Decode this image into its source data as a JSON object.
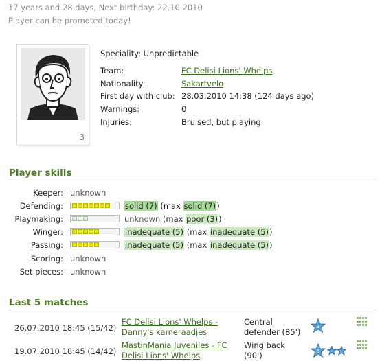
{
  "header": {
    "age_line": "17 years and 28 days, Next birthday: 22.10.2010",
    "promotion_line": "Player can be promoted today!"
  },
  "avatar": {
    "badge": "3"
  },
  "info": {
    "speciality_label": "Speciality:",
    "speciality_value": "Unpredictable",
    "team_label": "Team:",
    "team_value": "FC Delisi Lions' Whelps",
    "nationality_label": "Nationality:",
    "nationality_value": "Sakartvelo",
    "first_day_label": "First day with club:",
    "first_day_value": "28.03.2010 14:38 (124 days ago)",
    "warnings_label": "Warnings:",
    "warnings_value": "0",
    "injuries_label": "Injuries:",
    "injuries_value": "Bruised, but playing"
  },
  "skills": {
    "title": "Player skills",
    "rows": [
      {
        "label": "Keeper:",
        "text": "unknown"
      },
      {
        "label": "Defending:",
        "level": 7,
        "a": "solid (7)",
        "mid": " (max ",
        "b": "solid (7)",
        "end": ")"
      },
      {
        "label": "Playmaking:",
        "level": 3,
        "a": "unknown",
        "mid": " (max ",
        "b": "poor (3)",
        "end": ")"
      },
      {
        "label": "Winger:",
        "level": 5,
        "a": "inadequate (5)",
        "mid": " (max ",
        "b": "inadequate (5)",
        "end": ")"
      },
      {
        "label": "Passing:",
        "level": 5,
        "a": "inadequate (5)",
        "mid": " (max ",
        "b": "inadequate (5)",
        "end": ")"
      },
      {
        "label": "Scoring:",
        "text": "unknown"
      },
      {
        "label": "Set pieces:",
        "text": "unknown"
      }
    ]
  },
  "matches": {
    "title": "Last 5 matches",
    "rows": [
      {
        "date": "26.07.2010 18:45 (15/42)",
        "title_1": "FC Delisi Lions' Whelps -",
        "title_2": "Danny's kameraadjes",
        "pos_1": "Central",
        "pos_2": "defender (85')",
        "rating": "3"
      },
      {
        "date": "19.07.2010 18:45 (14/42)",
        "title_1": "MastinMania Juveniles - FC",
        "title_2": "Delisi Lions' Whelps",
        "pos_1": "Wing back",
        "pos_2": "(90')",
        "rating": "5"
      }
    ]
  },
  "colors": {
    "accent": "#4f7d28",
    "link": "#3a6e1d",
    "highlight": "#a8d89a",
    "star": "#4a8fcf"
  }
}
